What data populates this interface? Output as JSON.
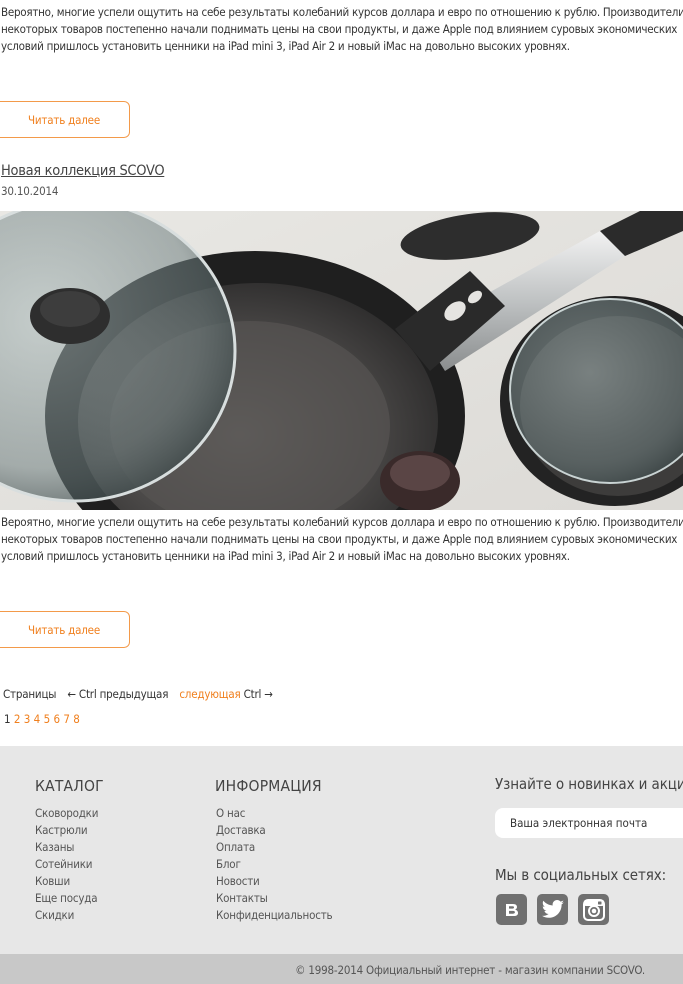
{
  "posts": [
    {
      "excerpt": "Вероятно, многие успели ощутить на себе результаты колебаний курсов доллара и евро по отношению к рублю. Производители некоторых товаров постепенно начали поднимать цены на свои продукты, и даже Apple под влиянием суровых экономических условий пришлось установить ценники на iPad mini 3, iPad Air 2 и новый iMac на довольно высоких уровнях.",
      "read_more": "Читать далее"
    },
    {
      "title": "Новая коллекция SCOVO",
      "date": "30.10.2014",
      "excerpt": "Вероятно, многие успели ощутить на себе результаты колебаний курсов доллара и евро по отношению к рублю. Производители некоторых товаров постепенно начали поднимать цены на свои продукты, и даже Apple под влиянием суровых экономических условий пришлось установить ценники на iPad mini 3, iPad Air 2 и новый iMac на довольно высоких уровнях.",
      "read_more": "Читать далее"
    }
  ],
  "pagination": {
    "label": "Страницы",
    "prev": "← Ctrl предыдущая",
    "next": "следующая",
    "next_suffix": "Ctrl →",
    "current": "1",
    "pages": [
      "2",
      "3",
      "4",
      "5",
      "6",
      "7",
      "8"
    ]
  },
  "footer": {
    "catalog": {
      "title": "КАТАЛОГ",
      "items": [
        "Сковородки",
        "Кастрюли",
        "Казаны",
        "Сотейники",
        "Ковши",
        "Еще посуда",
        "Скидки"
      ]
    },
    "info": {
      "title": "ИНФОРМАЦИЯ",
      "items": [
        "О нас",
        "Доставка",
        "Оплата",
        "Блог",
        "Новости",
        "Контакты",
        "Конфиденциальность"
      ]
    },
    "subscribe": {
      "title": "Узнайте о новинках и акциях",
      "placeholder": "Ваша электронная почта"
    },
    "social": {
      "title": "Мы в социальных сетях:",
      "networks": [
        "vk-icon",
        "twitter-icon",
        "instagram-icon"
      ]
    },
    "copyright": "© 1998-2014 Официальный интернет - магазин компании SCOVO."
  },
  "colors": {
    "accent": "#f07f1d",
    "footer_bg": "#e7e7e7",
    "footer_bottom_bg": "#c8c8c8",
    "social_bg": "#707070"
  }
}
